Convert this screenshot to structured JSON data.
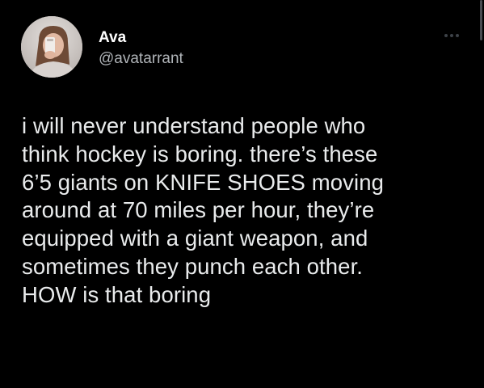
{
  "tweet": {
    "author": {
      "display_name": "Ava",
      "handle": "@avatarrant",
      "avatar": "avatar-photo"
    },
    "more_icon": "more-horizontal-icon",
    "text_lines": [
      "i will never understand people who",
      "think hockey is boring. there’s these",
      "6’5 giants on KNIFE SHOES moving",
      "around at 70 miles per hour, they’re",
      "equipped with a giant weapon, and",
      "sometimes they punch each other.",
      "HOW is that boring"
    ]
  }
}
